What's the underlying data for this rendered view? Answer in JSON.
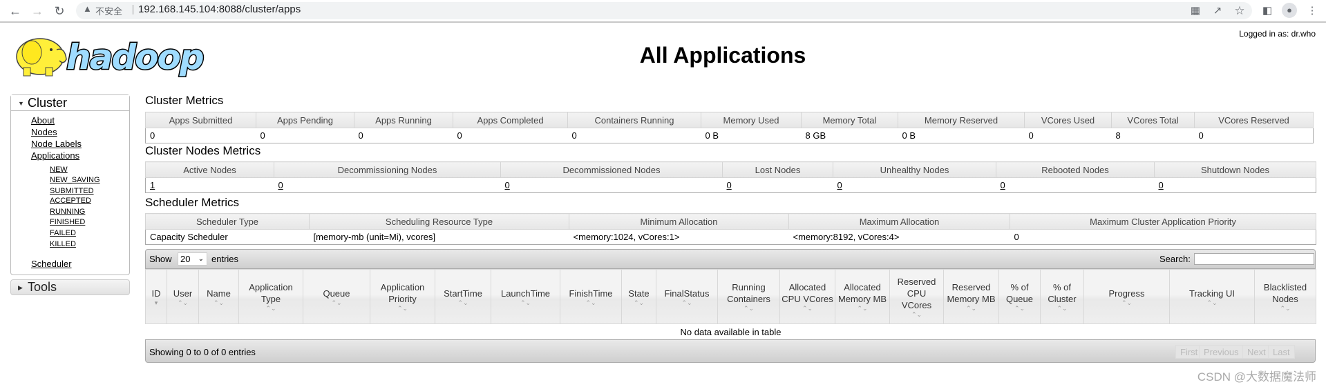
{
  "browser": {
    "insecure_label": "不安全",
    "url": "192.168.145.104:8088/cluster/apps",
    "warning_icon": "warning-triangle"
  },
  "header": {
    "logged_in": "Logged in as: dr.who",
    "title": "All Applications",
    "logo_text": "hadoop"
  },
  "sidebar": {
    "cluster_label": "Cluster",
    "links": [
      {
        "label": "About"
      },
      {
        "label": "Nodes"
      },
      {
        "label": "Node Labels"
      },
      {
        "label": "Applications"
      }
    ],
    "app_states": [
      {
        "label": "NEW"
      },
      {
        "label": "NEW_SAVING"
      },
      {
        "label": "SUBMITTED"
      },
      {
        "label": "ACCEPTED"
      },
      {
        "label": "RUNNING"
      },
      {
        "label": "FINISHED"
      },
      {
        "label": "FAILED"
      },
      {
        "label": "KILLED"
      }
    ],
    "scheduler_label": "Scheduler",
    "tools_label": "Tools"
  },
  "cluster_metrics": {
    "title": "Cluster Metrics",
    "headers": [
      "Apps Submitted",
      "Apps Pending",
      "Apps Running",
      "Apps Completed",
      "Containers Running",
      "Memory Used",
      "Memory Total",
      "Memory Reserved",
      "VCores Used",
      "VCores Total",
      "VCores Reserved"
    ],
    "values": [
      "0",
      "0",
      "0",
      "0",
      "0",
      "0 B",
      "8 GB",
      "0 B",
      "0",
      "8",
      "0"
    ]
  },
  "nodes_metrics": {
    "title": "Cluster Nodes Metrics",
    "headers": [
      "Active Nodes",
      "Decommissioning Nodes",
      "Decommissioned Nodes",
      "Lost Nodes",
      "Unhealthy Nodes",
      "Rebooted Nodes",
      "Shutdown Nodes"
    ],
    "values": [
      "1",
      "0",
      "0",
      "0",
      "0",
      "0",
      "0"
    ]
  },
  "scheduler_metrics": {
    "title": "Scheduler Metrics",
    "headers": [
      "Scheduler Type",
      "Scheduling Resource Type",
      "Minimum Allocation",
      "Maximum Allocation",
      "Maximum Cluster Application Priority"
    ],
    "values": [
      "Capacity Scheduler",
      "[memory-mb (unit=Mi), vcores]",
      "<memory:1024, vCores:1>",
      "<memory:8192, vCores:4>",
      "0"
    ]
  },
  "apps_table": {
    "show_label": "Show",
    "page_size": "20",
    "entries_label": "entries",
    "search_label": "Search:",
    "search_value": "",
    "columns": [
      "ID",
      "User",
      "Name",
      "Application Type",
      "Queue",
      "Application Priority",
      "StartTime",
      "LaunchTime",
      "FinishTime",
      "State",
      "FinalStatus",
      "Running Containers",
      "Allocated CPU VCores",
      "Allocated Memory MB",
      "Reserved CPU VCores",
      "Reserved Memory MB",
      "% of Queue",
      "% of Cluster",
      "Progress",
      "Tracking UI",
      "Blacklisted Nodes"
    ],
    "empty_message": "No data available in table",
    "info": "Showing 0 to 0 of 0 entries",
    "pagination": [
      "First",
      "Previous",
      "Next",
      "Last"
    ]
  },
  "watermark": "CSDN @大数据魔法师"
}
